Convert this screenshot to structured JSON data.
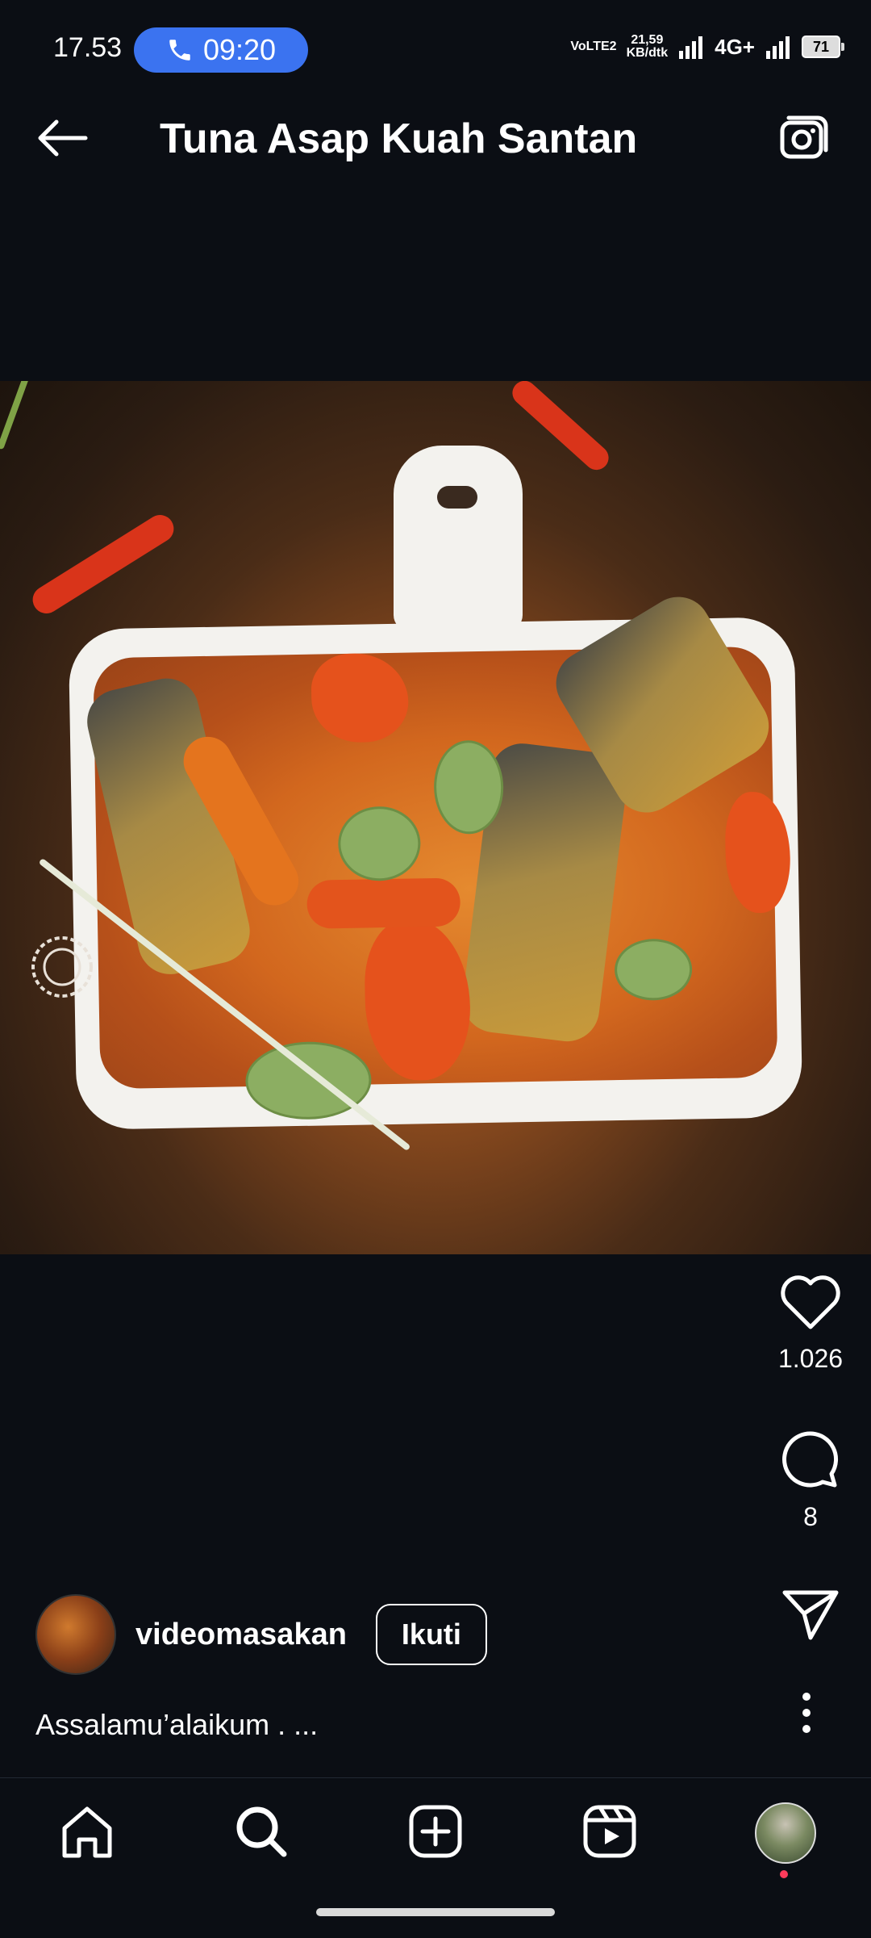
{
  "status_bar": {
    "time": "17.53",
    "call_timer": "09:20",
    "volte_label": "VoLTE2",
    "data_speed_value": "21,59",
    "data_speed_unit": "KB/dtk",
    "network_type": "4G+",
    "battery_level": "71"
  },
  "header": {
    "title": "Tuna Asap Kuah Santan"
  },
  "post": {
    "image_alt": "tuna-smoked-coconut-curry-dish",
    "likes": "1.026",
    "comments": "8",
    "author": "videomasakan",
    "follow_label": "Ikuti",
    "caption": "Assalamu’alaikum . ..."
  },
  "icons": {
    "back": "arrow-left-icon",
    "camera": "camera-icon",
    "like": "heart-icon",
    "comment": "comment-icon",
    "share": "send-icon",
    "more": "more-vertical-icon",
    "home": "home-icon",
    "search": "search-icon",
    "create": "add-post-icon",
    "reels": "reels-icon"
  },
  "colors": {
    "background": "#0b0e14",
    "call_pill": "#3b73f0",
    "notification_dot": "#ff3b5b"
  }
}
